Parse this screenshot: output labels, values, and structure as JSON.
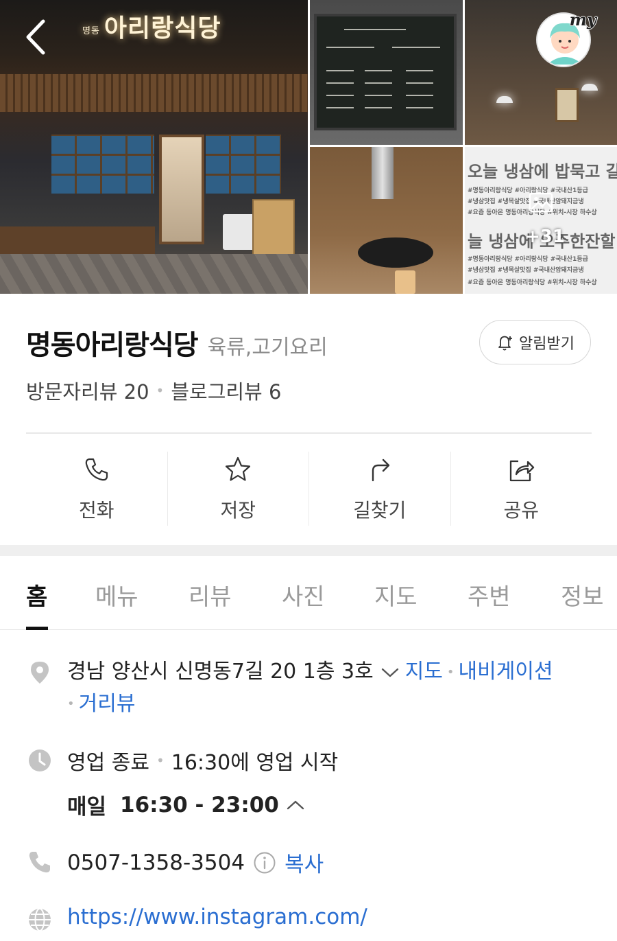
{
  "gallery": {
    "sign_small": "명동",
    "sign_main": "아리랑식당",
    "text_photo_line1": "오늘 냉삼에 밥묵고 갈래",
    "text_photo_tags1": "#명동아리랑식당 #아리랑식당 #국내산1등급",
    "text_photo_tags2": "#냉삼맛집 #냉목살맛집 #국내산암돼지금냉",
    "text_photo_tags3": "#요즘 동아온 명동아리랑식당 #위치-시장 하수상",
    "text_photo_line2": "늘 냉삼에 오주한잔할",
    "text_photo_tags4": "#명동아리랑식당 #아리랑식당 #국내산1등급",
    "text_photo_tags5": "#냉삼맛집 #냉목살맛집 #국내산암돼지금냉",
    "text_photo_tags6": "#요즘 동아온 명동아리랑식당 #위치-시장 하수상",
    "more_count": "+31",
    "my_label": "my"
  },
  "place": {
    "name": "명동아리랑식당",
    "category": "육류,고기요리",
    "notify_label": "알림받기",
    "visitor_reviews": "방문자리뷰 20",
    "blog_reviews": "블로그리뷰 6"
  },
  "actions": [
    {
      "label": "전화",
      "icon": "phone-icon"
    },
    {
      "label": "저장",
      "icon": "star-icon"
    },
    {
      "label": "길찾기",
      "icon": "directions-icon"
    },
    {
      "label": "공유",
      "icon": "share-icon"
    }
  ],
  "tabs": [
    "홈",
    "메뉴",
    "리뷰",
    "사진",
    "지도",
    "주변",
    "정보"
  ],
  "info": {
    "address": "경남 양산시 신명동7길 20 1층 3호",
    "map_link": "지도",
    "navi_link": "내비게이션",
    "street_link": "거리뷰",
    "status": "영업 종료",
    "status_detail": "16:30에 영업 시작",
    "day": "매일",
    "hours": "16:30 - 23:00",
    "phone": "0507-1358-3504",
    "copy": "복사",
    "url": "https://www.instagram.com/"
  },
  "colors": {
    "link": "#2a6ed1",
    "muted": "#8a8a8a",
    "divider": "#e8e8e8"
  }
}
